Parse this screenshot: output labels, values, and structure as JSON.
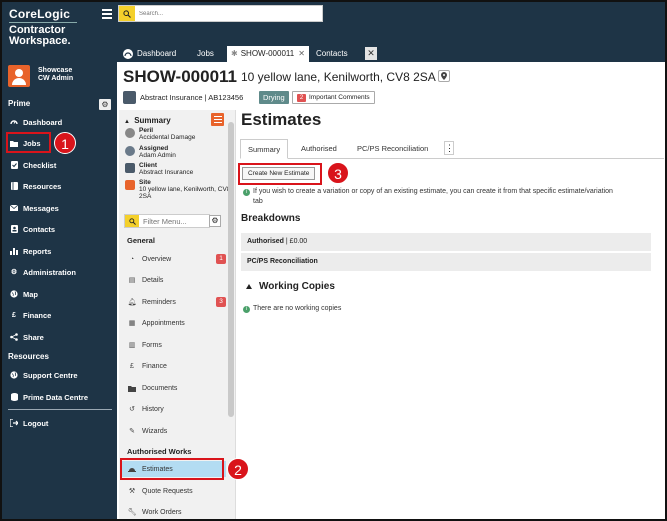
{
  "brand": {
    "logo": "CoreLogic",
    "subtitle_line1": "Contractor",
    "subtitle_line2": "Workspace."
  },
  "profile": {
    "name": "Showcase",
    "role": "CW Admin"
  },
  "sidebar": {
    "section_prime": "Prime",
    "items": [
      {
        "label": "Dashboard",
        "icon": "speedometer-icon"
      },
      {
        "label": "Jobs",
        "icon": "folder-icon"
      },
      {
        "label": "Checklist",
        "icon": "checklist-icon"
      },
      {
        "label": "Resources",
        "icon": "book-icon"
      },
      {
        "label": "Messages",
        "icon": "envelope-icon"
      },
      {
        "label": "Contacts",
        "icon": "contact-card-icon"
      },
      {
        "label": "Reports",
        "icon": "bar-chart-icon"
      },
      {
        "label": "Administration",
        "icon": "gear-icon"
      },
      {
        "label": "Map",
        "icon": "globe-icon"
      },
      {
        "label": "Finance",
        "icon": "pound-icon"
      },
      {
        "label": "Share",
        "icon": "share-icon"
      }
    ],
    "section_resources": "Resources",
    "resource_items": [
      {
        "label": "Support Centre",
        "icon": "globe-icon"
      },
      {
        "label": "Prime Data Centre",
        "icon": "database-icon"
      }
    ],
    "logout": "Logout"
  },
  "search": {
    "placeholder": "Search..."
  },
  "tabs": [
    {
      "label": "Dashboard"
    },
    {
      "label": "Jobs"
    },
    {
      "label": "SHOW-000011"
    },
    {
      "label": "Contacts"
    }
  ],
  "job": {
    "id": "SHOW-000011",
    "address": "10 yellow lane, Kenilworth, CV8 2SA",
    "insurer": "Abstract Insurance | AB123456",
    "status": "Drying",
    "important_count": "2",
    "important_label": "Important Comments"
  },
  "summary": {
    "title": "Summary",
    "rows": [
      {
        "label": "Peril",
        "value": "Accidental Damage"
      },
      {
        "label": "Assigned",
        "value": "Adam Admin"
      },
      {
        "label": "Client",
        "value": "Abstract Insurance"
      },
      {
        "label": "Site",
        "value": "10 yellow lane, Kenilworth, CV8 2SA"
      }
    ]
  },
  "filter": {
    "placeholder": "Filter Menu..."
  },
  "menu": {
    "general_head": "General",
    "general": [
      {
        "label": "Overview",
        "badge": "1"
      },
      {
        "label": "Details",
        "badge": ""
      },
      {
        "label": "Reminders",
        "badge": "3"
      },
      {
        "label": "Appointments",
        "badge": ""
      },
      {
        "label": "Forms",
        "badge": ""
      },
      {
        "label": "Finance",
        "badge": ""
      },
      {
        "label": "Documents",
        "badge": ""
      },
      {
        "label": "History",
        "badge": ""
      },
      {
        "label": "Wizards",
        "badge": ""
      }
    ],
    "authorised_head": "Authorised Works",
    "authorised": [
      {
        "label": "Estimates"
      },
      {
        "label": "Quote Requests"
      },
      {
        "label": "Work Orders"
      }
    ]
  },
  "content": {
    "title": "Estimates",
    "tabs": [
      {
        "label": "Summary"
      },
      {
        "label": "Authorised"
      },
      {
        "label": "PC/PS Reconciliation"
      }
    ],
    "create_button": "Create New Estimate",
    "info_text_1": "If you wish to create a variation or copy of an existing estimate, you can create it from that specific estimate/variation",
    "info_text_2": "tab",
    "breakdowns_title": "Breakdowns",
    "authorised_label": "Authorised",
    "authorised_value": "| £0.00",
    "pcps_label": "PC/PS Reconciliation",
    "working_copies_title": "Working Copies",
    "no_working_copies": "There are no working copies"
  },
  "callouts": [
    "1",
    "2",
    "3"
  ],
  "colors": {
    "sidebar_bg": "#1e3446",
    "accent_orange": "#e8632b",
    "search_yellow": "#f4d02b",
    "status_drying": "#5f8a8a",
    "highlight_red": "#d9141b",
    "selected_blue": "#b3dcf2"
  }
}
